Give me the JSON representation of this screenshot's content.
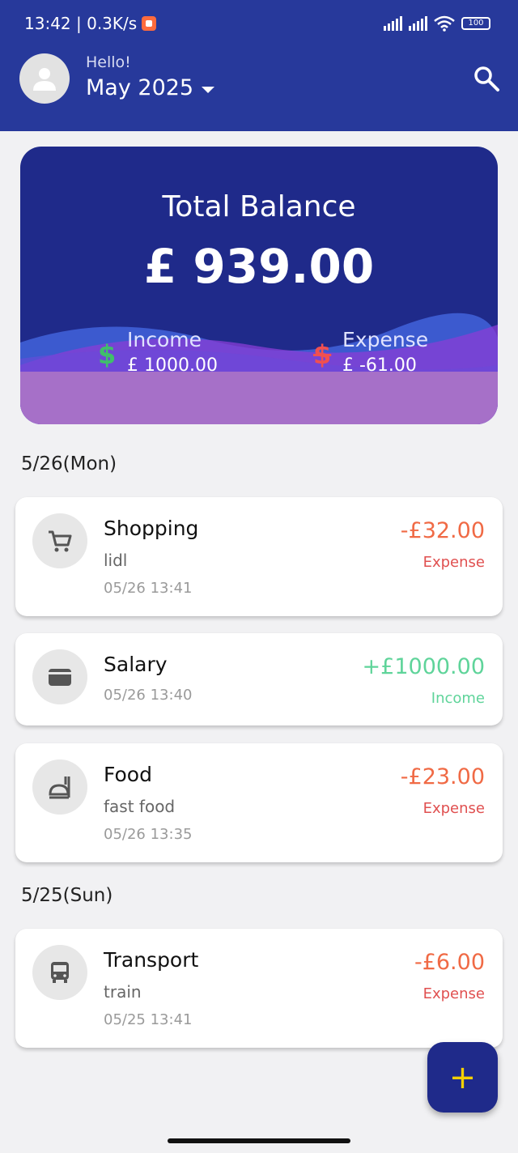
{
  "status_bar": {
    "time_speed": "13:42 | 0.3K/s",
    "battery": "100"
  },
  "header": {
    "greeting": "Hello!",
    "month": "May 2025"
  },
  "balance": {
    "title": "Total Balance",
    "amount": "£ 939.00",
    "income_label": "Income",
    "income_value": "£ 1000.00",
    "expense_label": "Expense",
    "expense_value": "£ -61.00",
    "income_icon": "$",
    "expense_icon": "$"
  },
  "groups": [
    {
      "date": "5/26(Mon)",
      "items": [
        {
          "icon": "cart-icon",
          "title": "Shopping",
          "note": "lidl",
          "time": "05/26 13:41",
          "amount": "-£32.00",
          "type": "Expense"
        },
        {
          "icon": "wallet-icon",
          "title": "Salary",
          "note": "",
          "time": "05/26 13:40",
          "amount": "+£1000.00",
          "type": "Income"
        },
        {
          "icon": "food-icon",
          "title": "Food",
          "note": "fast food",
          "time": "05/26 13:35",
          "amount": "-£23.00",
          "type": "Expense"
        }
      ]
    },
    {
      "date": "5/25(Sun)",
      "items": [
        {
          "icon": "bus-icon",
          "title": "Transport",
          "note": "train",
          "time": "05/25 13:41",
          "amount": "-£6.00",
          "type": "Expense"
        }
      ]
    }
  ],
  "fab": {
    "label": "+"
  },
  "colors": {
    "header": "#27399b",
    "card": "#1f2a8a",
    "expense_amount": "#f06a45",
    "expense_label": "#e05050",
    "income": "#5fd49a",
    "income_icon": "#3fbf6a",
    "expense_icon": "#f05050",
    "fab_plus": "#f5d000"
  }
}
